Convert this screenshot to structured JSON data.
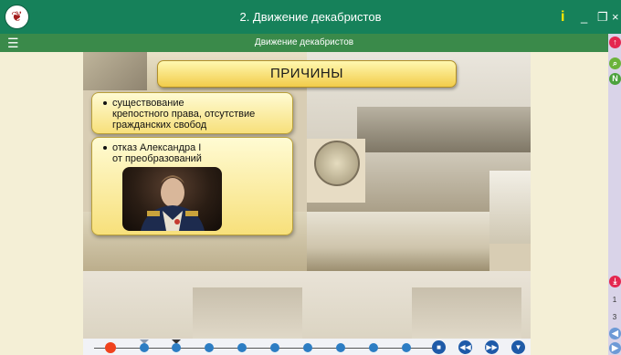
{
  "window": {
    "title": "2. Движение декабристов",
    "info_label": "i",
    "minimize_label": "_",
    "restore_label": "❐",
    "close_label": "×",
    "emblem_glyph": "❦"
  },
  "subheader": {
    "menu_label": "☰",
    "title": "Движение декабристов"
  },
  "slide": {
    "heading": "ПРИЧИНЫ",
    "reason1": [
      "существование",
      "крепостного права, отсутствие",
      "гражданских свобод"
    ],
    "reason2": [
      "отказ Александра I",
      "от преобразований"
    ]
  },
  "right_sidebar": {
    "btn_top": "↑",
    "btn_search": "⌕",
    "btn_note": "N",
    "btn_pdf": "⤓",
    "page_current": "1",
    "page_total": "3",
    "btn_prev": "◀",
    "btn_next": "▶"
  },
  "timeline": {
    "active_index": 0,
    "points": 12,
    "controls": {
      "stop": "■",
      "rewind": "◀◀",
      "forward": "▶▶",
      "down": "▼"
    }
  },
  "colors": {
    "titlebar": "#16815a",
    "subbar": "#3a8a4a",
    "card": "#f7e07b",
    "timeline_dot": "#2d7dc3",
    "timeline_active": "#f0421d"
  }
}
